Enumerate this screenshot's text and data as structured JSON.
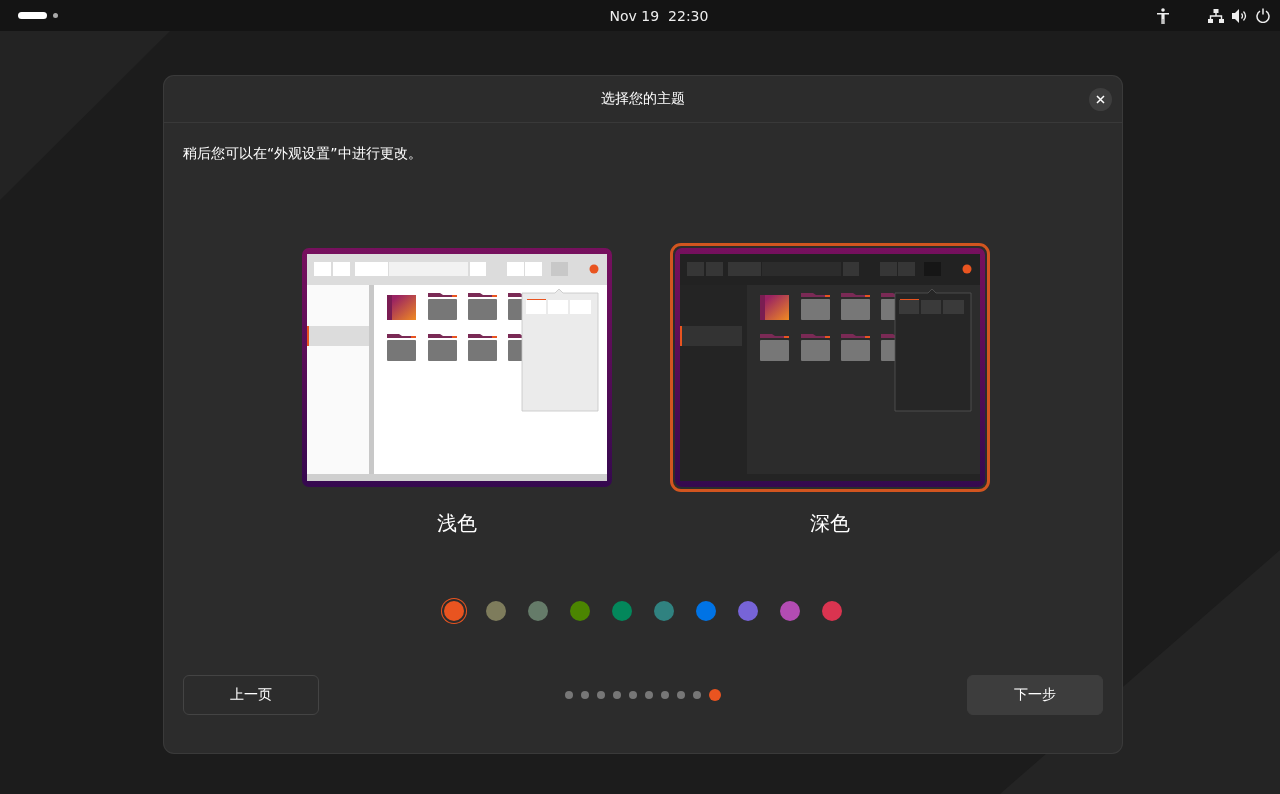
{
  "top_bar": {
    "clock": "Nov 19  22:30"
  },
  "dialog": {
    "title": "选择您的主题",
    "subtitle": "稍后您可以在“外观设置”中进行更改。",
    "themes": [
      {
        "kind": "light",
        "label": "浅色",
        "selected": false
      },
      {
        "kind": "dark",
        "label": "深色",
        "selected": true
      }
    ],
    "accent_colors": [
      {
        "color": "#e95420",
        "selected": true
      },
      {
        "color": "#7e7c5c",
        "selected": false
      },
      {
        "color": "#657b69",
        "selected": false
      },
      {
        "color": "#4b8501",
        "selected": false
      },
      {
        "color": "#03875b",
        "selected": false
      },
      {
        "color": "#308280",
        "selected": false
      },
      {
        "color": "#0073e5",
        "selected": false
      },
      {
        "color": "#7764d8",
        "selected": false
      },
      {
        "color": "#b34cb3",
        "selected": false
      },
      {
        "color": "#da3450",
        "selected": false
      }
    ],
    "back_button": "上一页",
    "pages": [
      {
        "selected": false
      },
      {
        "selected": false
      },
      {
        "selected": false
      },
      {
        "selected": false
      },
      {
        "selected": false
      },
      {
        "selected": false
      },
      {
        "selected": false
      },
      {
        "selected": false
      },
      {
        "selected": false
      },
      {
        "selected": true
      }
    ],
    "next_button": "下一步"
  }
}
